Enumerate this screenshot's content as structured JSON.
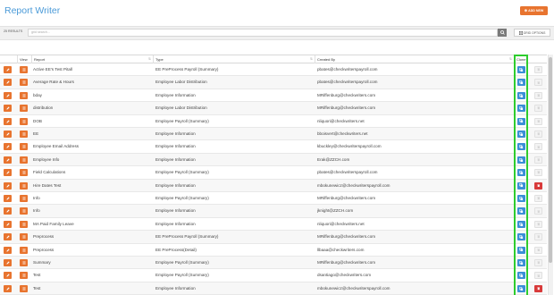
{
  "header": {
    "title": "Report Writer",
    "add_label": "ADD NEW"
  },
  "toolbar": {
    "results_label": "25 RESULTS",
    "search_placeholder": "grid search...",
    "grid_options_label": "GRID OPTIONS"
  },
  "columns": {
    "view": "View",
    "report": "Report",
    "type": "Type",
    "created_by": "Created By",
    "clone": "Clone"
  },
  "rows": [
    {
      "report": "Active EE's Test Pitall",
      "type": "EE PreProcess Payroll (Summary)",
      "created_by": "pbates@checkwriterspayroll.com",
      "deletable": false
    },
    {
      "report": "Average Rate & Hours",
      "type": "Employee Labor Distribution",
      "created_by": "pbates@checkwriterspayroll.com",
      "deletable": false
    },
    {
      "report": "bday",
      "type": "Employee Information",
      "created_by": "MRiffenburg@checkwriters.com",
      "deletable": false
    },
    {
      "report": "distribution",
      "type": "Employee Labor Distribution",
      "created_by": "MRiffenburg@checkwriters.com",
      "deletable": false
    },
    {
      "report": "DOB",
      "type": "Employee Payroll (Summary)",
      "created_by": "nliquori@checkwriters.net",
      "deletable": false
    },
    {
      "report": "EE",
      "type": "Employee Information",
      "created_by": "bboisvert@checkwriters.net",
      "deletable": false
    },
    {
      "report": "Employee Email Address",
      "type": "Employee Information",
      "created_by": "kbuckley@checkwriterspayroll.com",
      "deletable": false
    },
    {
      "report": "Employee Info",
      "type": "Employee Information",
      "created_by": "Erak@ZZCH.com",
      "deletable": false
    },
    {
      "report": "Field Calculations",
      "type": "Employee Payroll (Summary)",
      "created_by": "pbates@checkwriterspayroll.com",
      "deletable": false
    },
    {
      "report": "Hire Dates Test",
      "type": "Employee Information",
      "created_by": "mbokunewicz@checkwriterspayroll.com",
      "deletable": true
    },
    {
      "report": "Info",
      "type": "Employee Payroll (Summary)",
      "created_by": "MRiffenburg@checkwriters.com",
      "deletable": false
    },
    {
      "report": "Info",
      "type": "Employee Information",
      "created_by": "jknight@ZZCH.com",
      "deletable": false
    },
    {
      "report": "MA Paid Family Leave",
      "type": "Employee Information",
      "created_by": "nliquori@checkwriters.net",
      "deletable": false
    },
    {
      "report": "Preprocess",
      "type": "EE PreProcess Payroll (Summary)",
      "created_by": "MRiffenburg@checkwriters.com",
      "deletable": false
    },
    {
      "report": "Preprocess",
      "type": "EE PreProcess(Detail)",
      "created_by": "llbaaa@checkwriters.com",
      "deletable": false
    },
    {
      "report": "Summary",
      "type": "Employee Payroll (Summary)",
      "created_by": "MRiffenburg@checkwriters.com",
      "deletable": false
    },
    {
      "report": "Test",
      "type": "Employee Payroll (Summary)",
      "created_by": "dsantiago@checkwriters.com",
      "deletable": false
    },
    {
      "report": "Test",
      "type": "Employee Information",
      "created_by": "mbokunewicz@checkwriterspayroll.com",
      "deletable": true
    }
  ],
  "colors": {
    "accent_orange": "#e8742f",
    "clone_blue": "#3a8fd6",
    "delete_red": "#d83a3a",
    "highlight_green": "#2ecc2e",
    "title_blue": "#4a9ad8"
  },
  "icons": {
    "edit": "pencil-icon",
    "view": "list-icon",
    "clone": "copy-icon",
    "delete": "trash-icon",
    "search": "search-icon",
    "grid_options": "grid-icon",
    "add": "plus-icon"
  }
}
